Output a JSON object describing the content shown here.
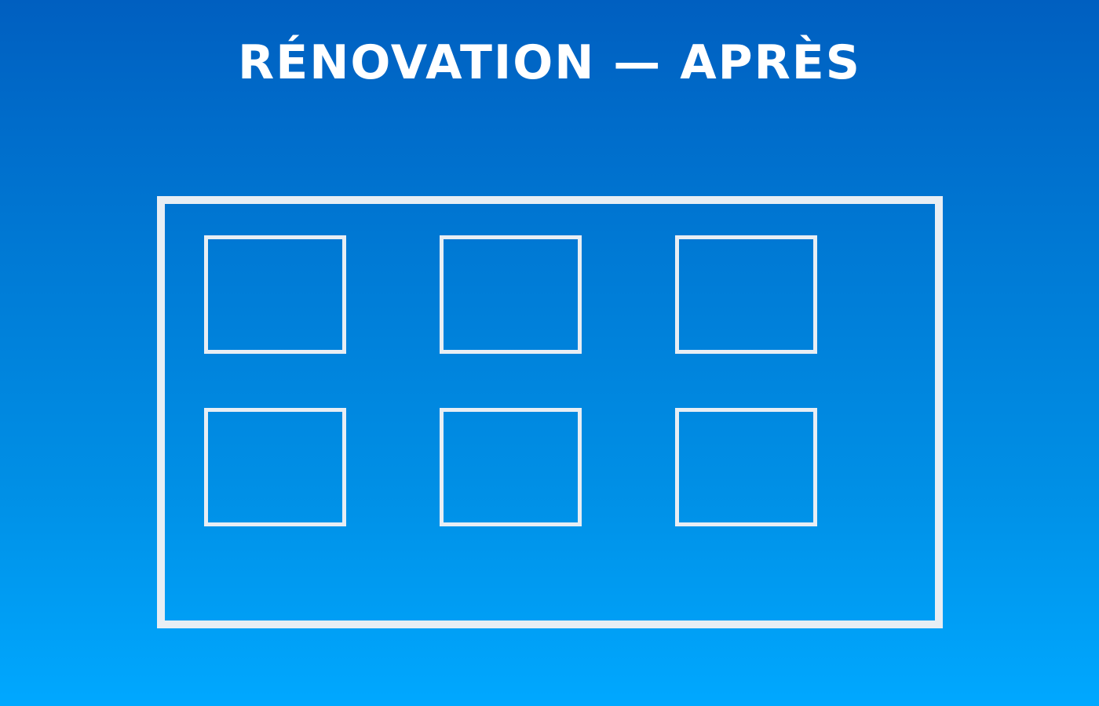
{
  "header": {
    "title": "RÉNOVATION — APRÈS"
  },
  "building": {
    "window_rows": 2,
    "windows_per_row": 3,
    "frame_color": "#e8eef4"
  },
  "colors": {
    "background_top": "#005fc0",
    "background_bottom": "#00a8ff",
    "title_text": "#ffffff"
  }
}
